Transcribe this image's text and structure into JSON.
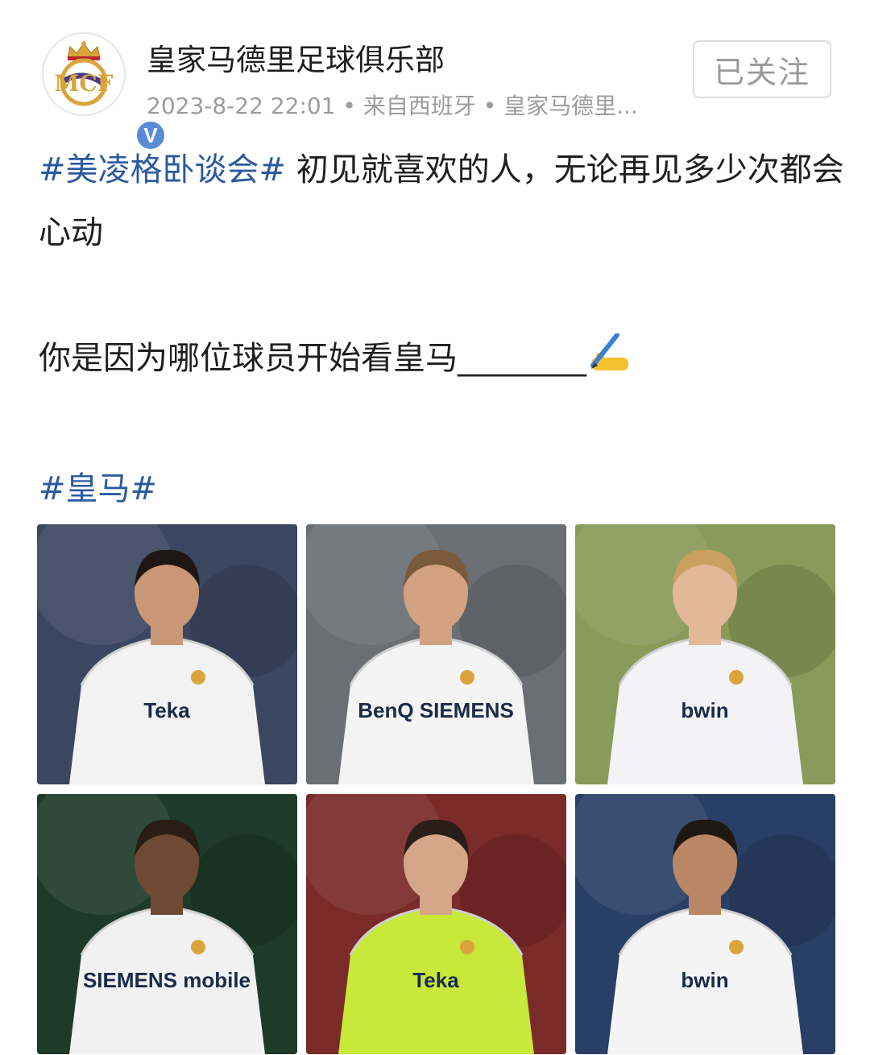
{
  "account": {
    "name": "皇家马德里足球俱乐部",
    "meta": "2023-8-22 22:01 • 来自西班牙 • 皇家马德里...",
    "verified_badge": "V",
    "avatar_icon": "real-madrid-crest-icon"
  },
  "follow_button": {
    "label": "已关注"
  },
  "post": {
    "hashtag_topic": "#美凌格卧谈会#",
    "line1_text": " 初见就喜欢的人，无论再见多少次都会心动",
    "question": "你是因为哪位球员开始看皇马________",
    "question_emoji": "writing-hand-icon",
    "hashtag_club": "#皇马#"
  },
  "photos": [
    {
      "icon": "player-photo-icon",
      "jersey_text": "Teka",
      "shirt": "#f2f2f2",
      "bg": "#3b4660"
    },
    {
      "icon": "player-photo-icon",
      "jersey_text": "BenQ SIEMENS",
      "shirt": "#f4f4f4",
      "bg": "#6b6f74"
    },
    {
      "icon": "player-photo-icon",
      "jersey_text": "bwin",
      "shirt": "#f3f3f6",
      "bg": "#8a9a5a"
    },
    {
      "icon": "player-photo-icon",
      "jersey_text": "SIEMENS mobile",
      "shirt": "#f1f1f1",
      "bg": "#1e3a2a"
    },
    {
      "icon": "player-photo-icon",
      "jersey_text": "Teka",
      "shirt": "#c8e83a",
      "bg": "#7a2a28"
    },
    {
      "icon": "player-photo-icon",
      "jersey_text": "bwin",
      "shirt": "#f4f4f4",
      "bg": "#2a3f66"
    }
  ],
  "colors": {
    "hashtag": "#2b5a9e",
    "meta_text": "#9c9c9c",
    "verified": "#5a8ad6"
  }
}
